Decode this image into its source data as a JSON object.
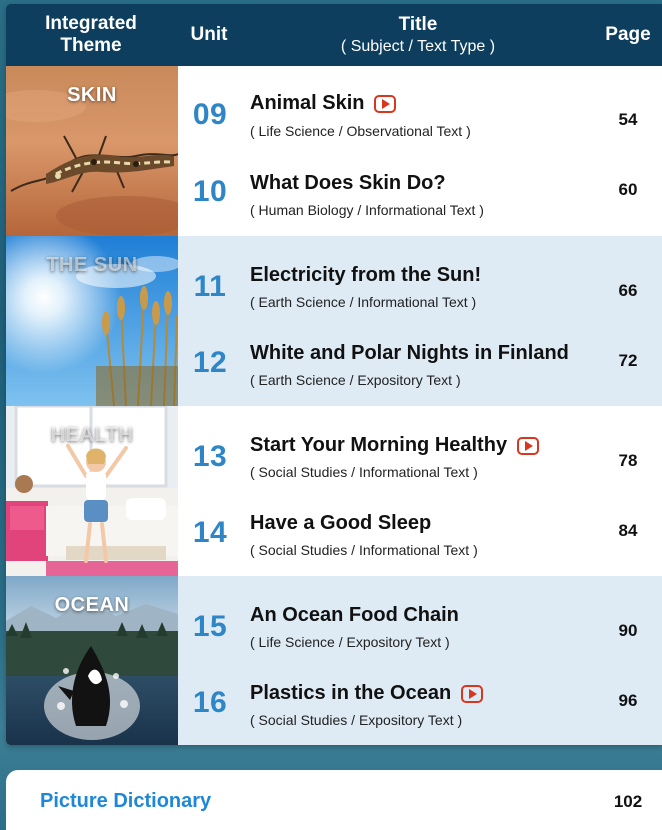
{
  "header": {
    "theme_line1": "Integrated",
    "theme_line2": "Theme",
    "unit": "Unit",
    "title": "Title",
    "title_sub": "( Subject / Text Type )",
    "page": "Page"
  },
  "themes": [
    {
      "label": "SKIN",
      "units": [
        {
          "number": "09",
          "title": "Animal Skin",
          "subject": "( Life Science / Observational Text )",
          "page": "54",
          "video": true
        },
        {
          "number": "10",
          "title": "What Does Skin Do?",
          "subject": "( Human Biology / Informational Text )",
          "page": "60",
          "video": false
        }
      ]
    },
    {
      "label": "THE SUN",
      "units": [
        {
          "number": "11",
          "title": "Electricity from the Sun!",
          "subject": "( Earth Science / Informational Text )",
          "page": "66",
          "video": false
        },
        {
          "number": "12",
          "title": "White and Polar Nights in Finland",
          "subject": "( Earth Science / Expository Text )",
          "page": "72",
          "video": false
        }
      ]
    },
    {
      "label": "HEALTH",
      "units": [
        {
          "number": "13",
          "title": "Start Your Morning Healthy",
          "subject": "( Social Studies / Informational Text )",
          "page": "78",
          "video": true
        },
        {
          "number": "14",
          "title": "Have a Good Sleep",
          "subject": "( Social Studies / Informational Text )",
          "page": "84",
          "video": false
        }
      ]
    },
    {
      "label": "OCEAN",
      "units": [
        {
          "number": "15",
          "title": "An Ocean Food Chain",
          "subject": "( Life Science / Expository Text )",
          "page": "90",
          "video": false
        },
        {
          "number": "16",
          "title": "Plastics in the Ocean",
          "subject": "( Social Studies / Expository Text )",
          "page": "96",
          "video": true
        }
      ]
    }
  ],
  "picture_dictionary": {
    "label": "Picture Dictionary",
    "page": "102"
  },
  "colors": {
    "header_bg": "#0d3e5d",
    "unit_number": "#2e86c6",
    "row_alt": "#deebf5",
    "video_icon": "#d8361f",
    "dictionary_label": "#1e88d6"
  },
  "icons": {
    "video": "play-video-icon"
  }
}
